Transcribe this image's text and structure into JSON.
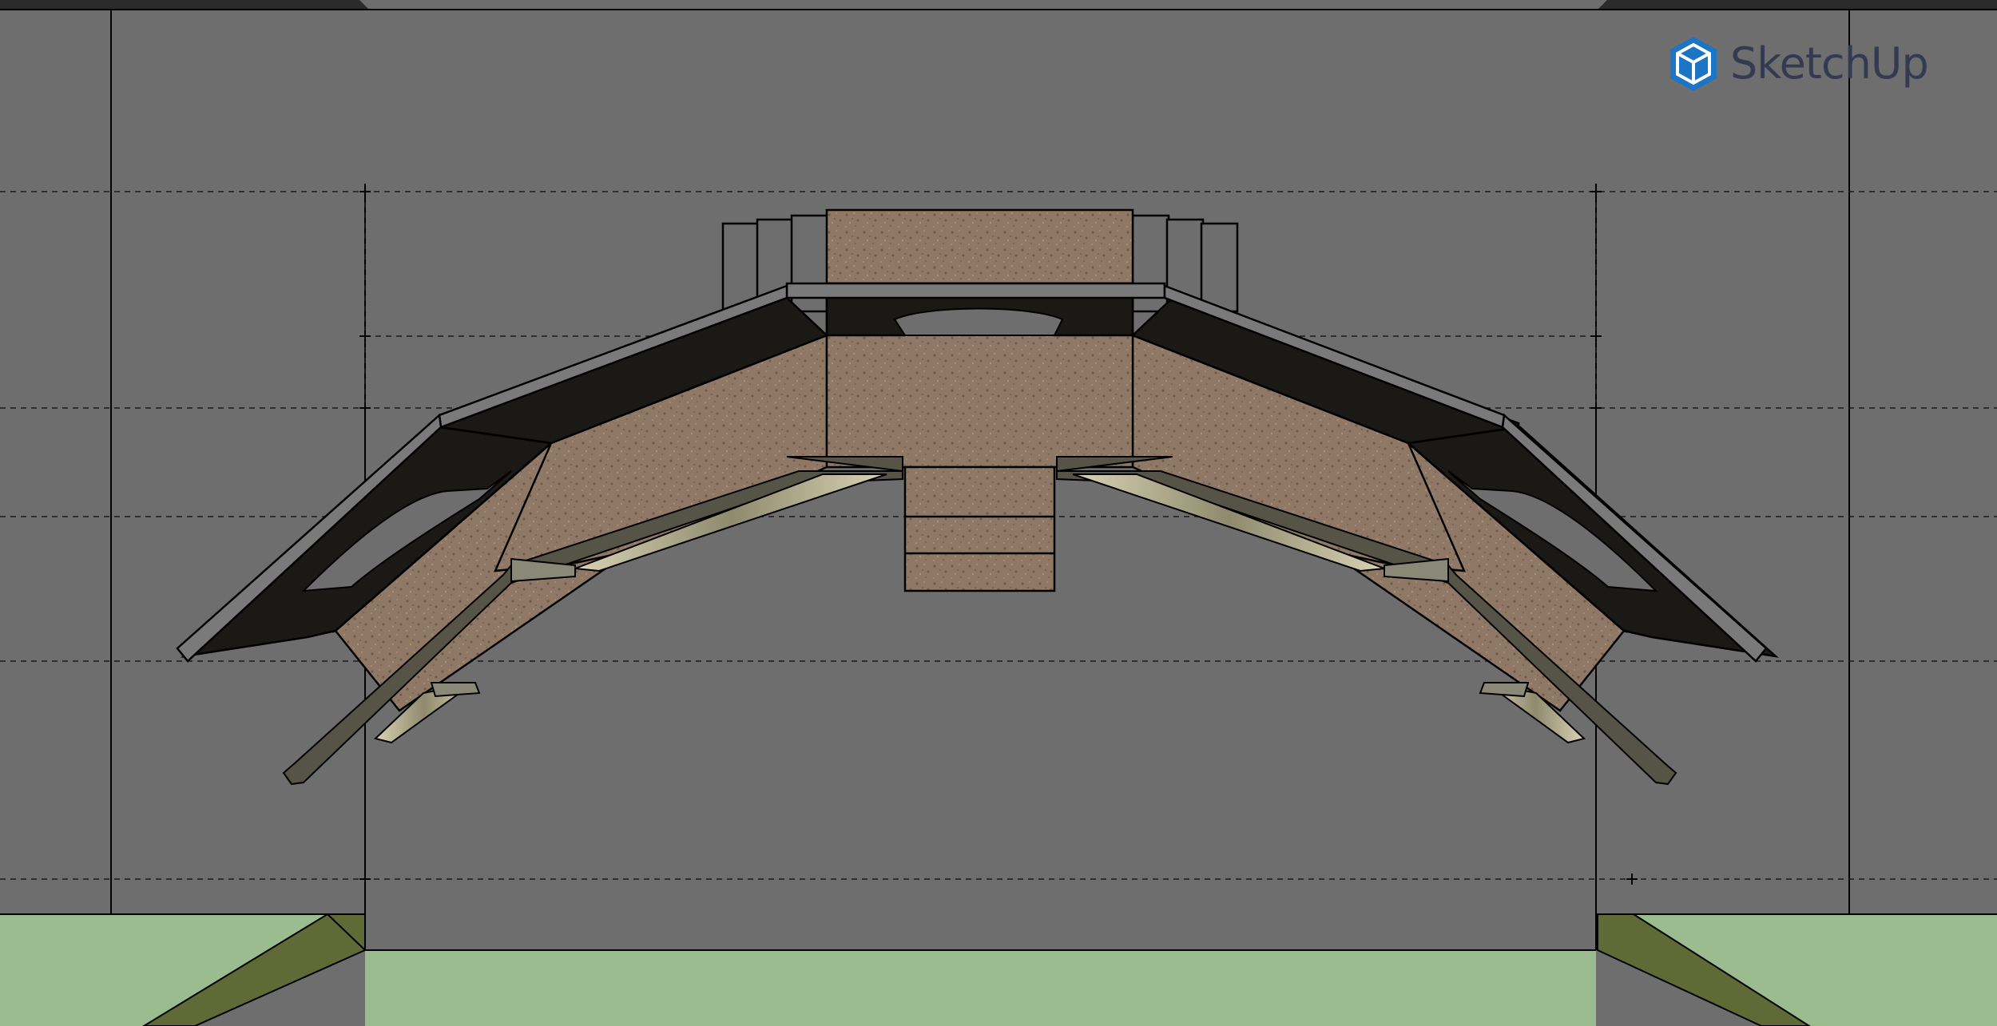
{
  "app": {
    "watermark": {
      "brand": "SketchUp",
      "icon": "sketchup-logo-icon"
    }
  },
  "colors": {
    "background": "#6e6e6e",
    "ground": "#9bbc8f",
    "ground_edge": "#5f6a36",
    "dark_panel": "#1b1915",
    "stone": "#8f7966",
    "light_strip": "#d8d2b2",
    "edge": "#000000",
    "logo": "#1b74c4",
    "wordmark": "#343a52"
  }
}
